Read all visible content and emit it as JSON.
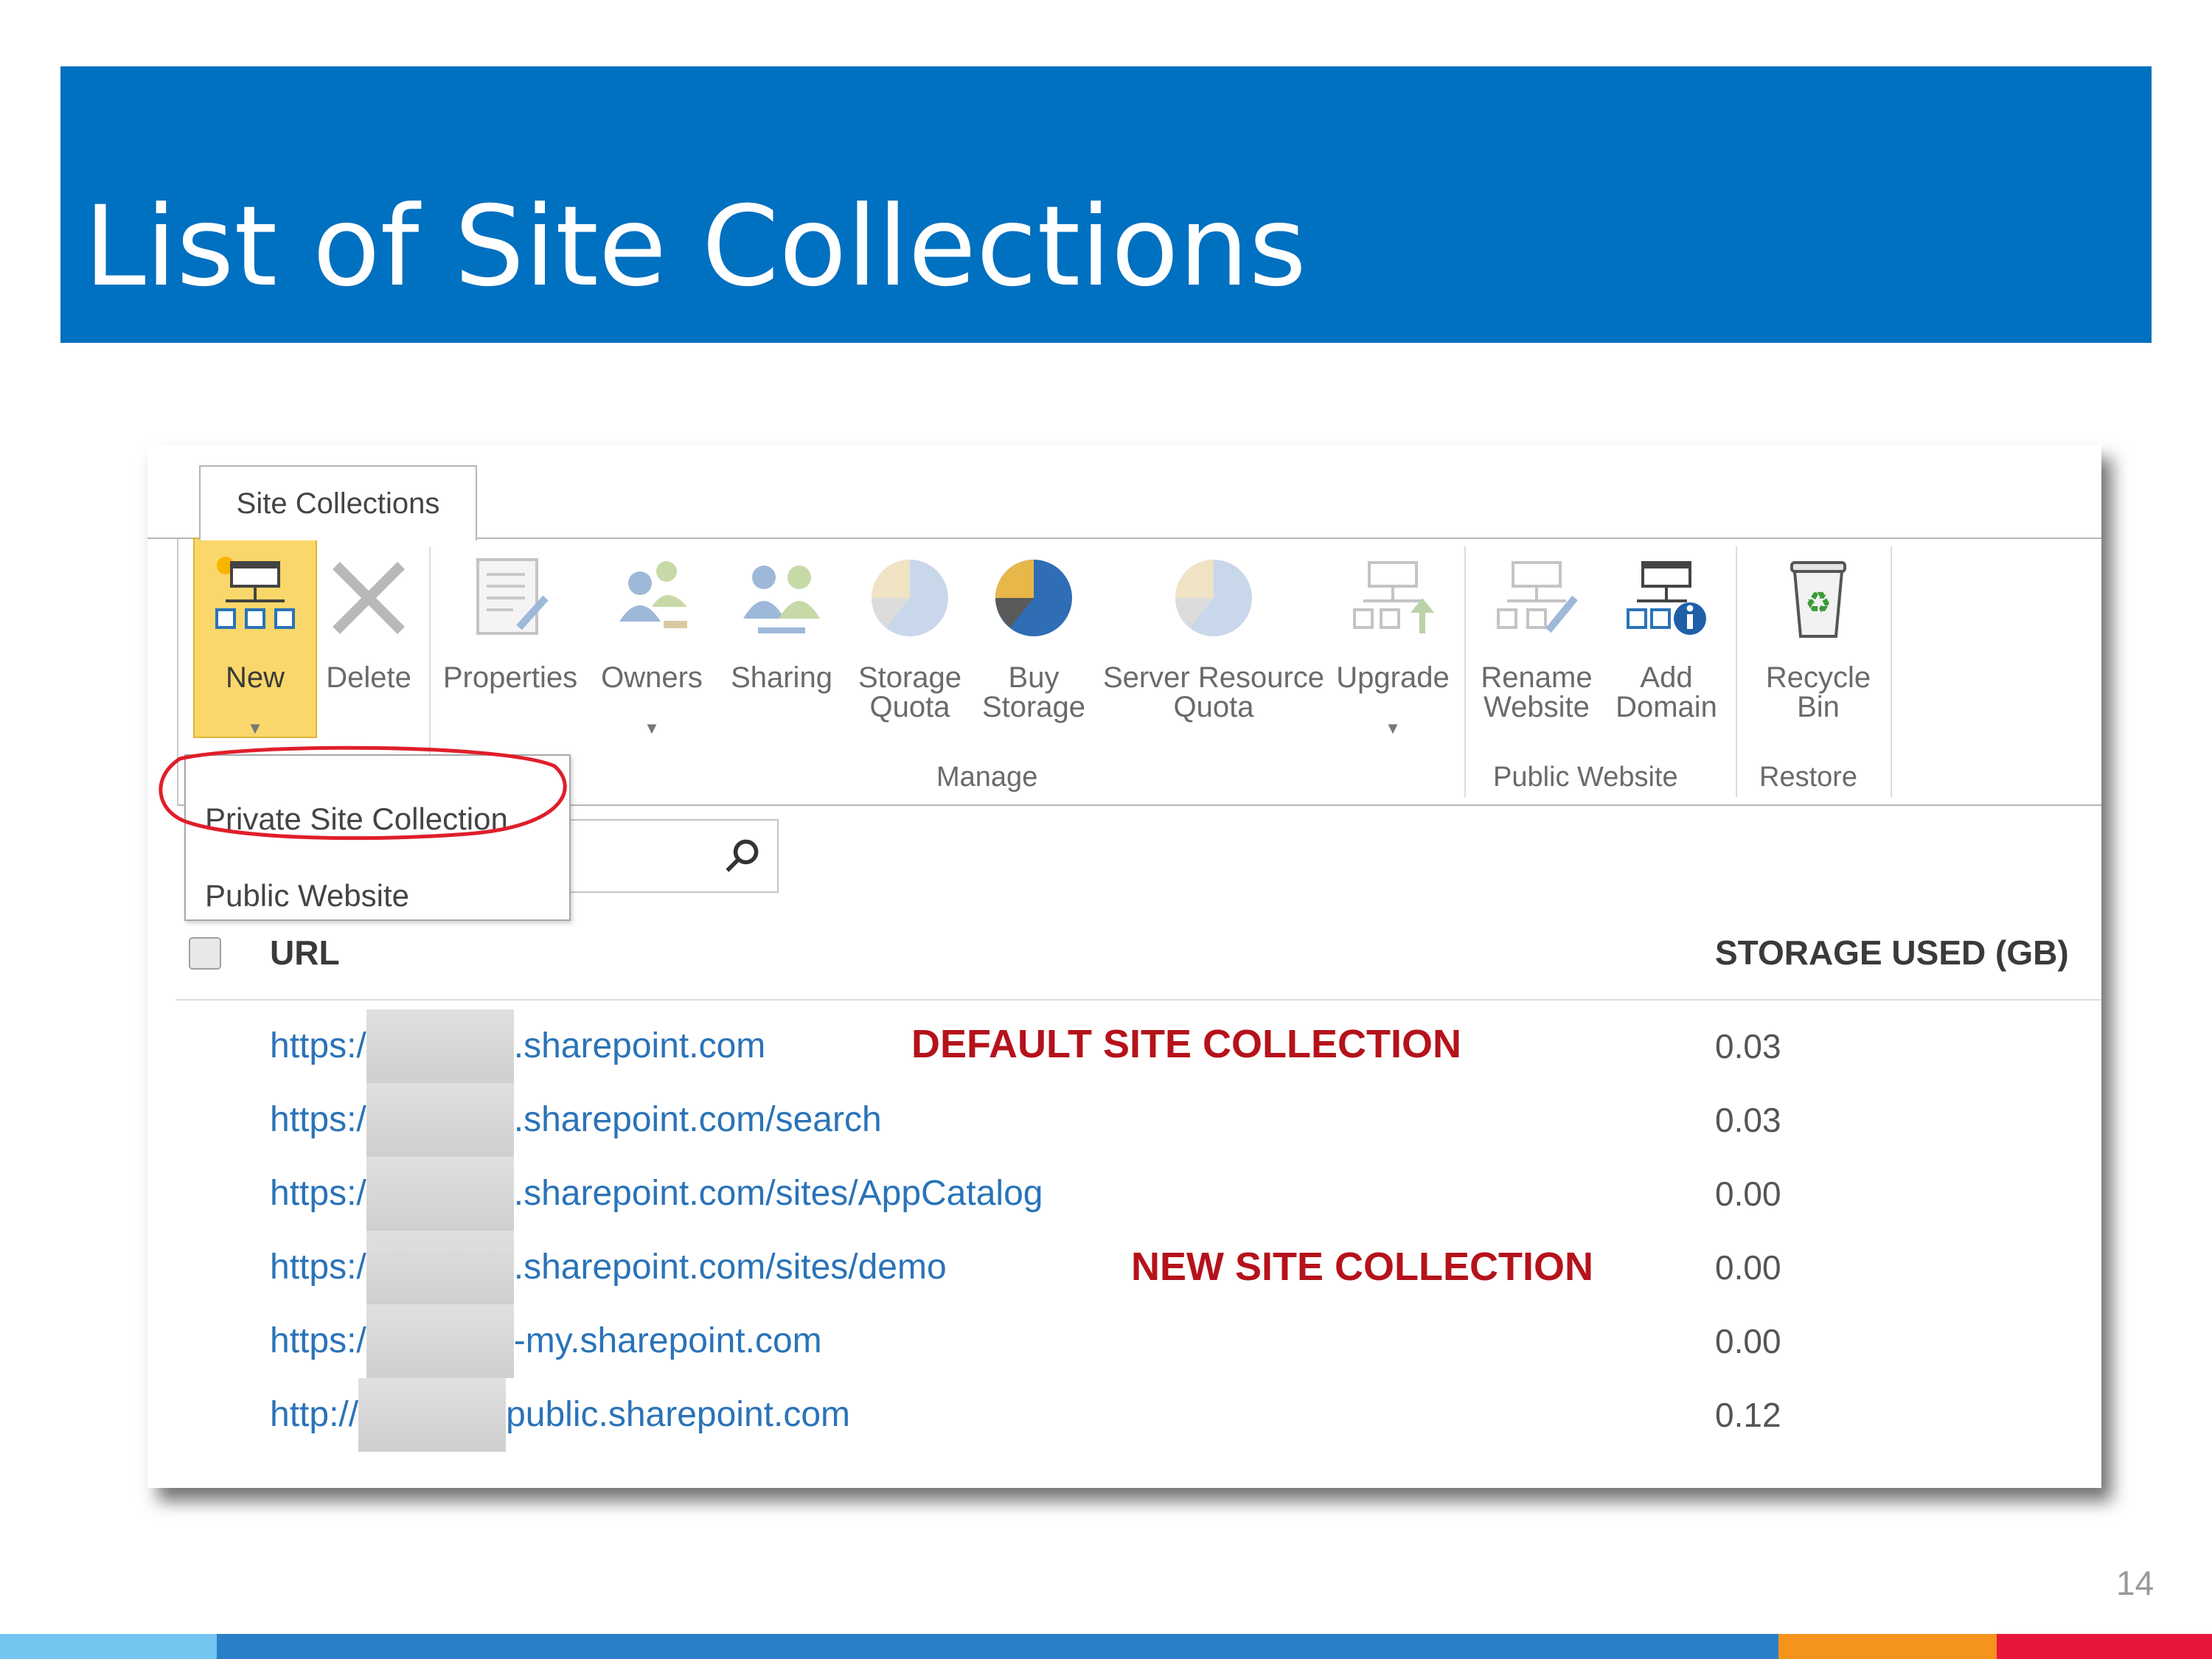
{
  "slide": {
    "title": "List of Site Collections",
    "page_number": "14"
  },
  "colors": {
    "title_bar": "#0070c0",
    "accent_link": "#2a73b8",
    "note_red": "#b5121b",
    "new_button_highlight": "#f9d76a",
    "bottom_bar": [
      "#74c6f0",
      "#2a7fc8",
      "#f5941d",
      "#e8163c"
    ]
  },
  "ribbon": {
    "tab_label": "Site Collections",
    "buttons": [
      {
        "label": "New",
        "icon": "new-site-icon",
        "has_dropdown": true
      },
      {
        "label": "Delete",
        "icon": "delete-x-icon"
      },
      {
        "label": "Properties",
        "icon": "properties-icon"
      },
      {
        "label": "Owners",
        "icon": "owners-icon",
        "has_dropdown": true
      },
      {
        "label": "Sharing",
        "icon": "sharing-icon"
      },
      {
        "label": "Storage\nQuota",
        "icon": "storage-quota-pie-icon"
      },
      {
        "label": "Buy\nStorage",
        "icon": "buy-storage-pie-icon"
      },
      {
        "label": "Server Resource\nQuota",
        "icon": "server-resource-pie-icon"
      },
      {
        "label": "Upgrade",
        "icon": "upgrade-icon",
        "has_dropdown": true
      },
      {
        "label": "Rename\nWebsite",
        "icon": "rename-website-icon"
      },
      {
        "label": "Add\nDomain",
        "icon": "add-domain-icon"
      },
      {
        "label": "Recycle\nBin",
        "icon": "recycle-bin-icon"
      }
    ],
    "groups": [
      "Manage",
      "Public Website",
      "Restore"
    ]
  },
  "new_dropdown": {
    "items": [
      "Private Site Collection",
      "Public Website"
    ]
  },
  "table": {
    "columns": [
      "URL",
      "STORAGE USED (GB)"
    ],
    "rows": [
      {
        "url_prefix": "https:/",
        "url_suffix": ".sharepoint.com",
        "storage": "0.03"
      },
      {
        "url_prefix": "https:/",
        "url_suffix": ".sharepoint.com/search",
        "storage": "0.03"
      },
      {
        "url_prefix": "https:/",
        "url_suffix": ".sharepoint.com/sites/AppCatalog",
        "storage": "0.00"
      },
      {
        "url_prefix": "https:/",
        "url_suffix": ".sharepoint.com/sites/demo",
        "storage": "0.00"
      },
      {
        "url_prefix": "https:/",
        "url_suffix": "-my.sharepoint.com",
        "storage": "0.00"
      },
      {
        "url_prefix": "http://",
        "url_suffix": "public.sharepoint.com",
        "storage": "0.12"
      }
    ]
  },
  "annotations": {
    "default": "DEFAULT SITE COLLECTION",
    "new": "NEW SITE COLLECTION"
  }
}
